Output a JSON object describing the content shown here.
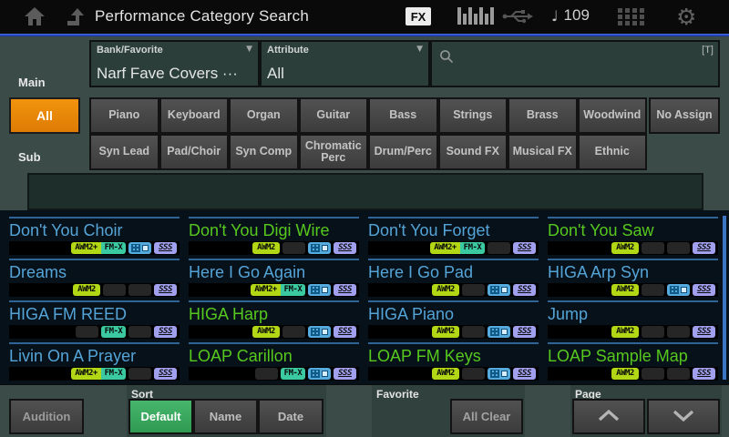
{
  "topbar": {
    "title": "Performance Category Search",
    "fx_badge": "FX",
    "tempo_value": "109",
    "tempo_note_glyph": "♩",
    "gear_glyph": "⚙"
  },
  "filters": {
    "main_label": "Main",
    "sub_label": "Sub",
    "bank": {
      "label": "Bank/Favorite",
      "value": "Narf Fave Covers ···"
    },
    "attribute": {
      "label": "Attribute",
      "value": "All"
    },
    "search": {
      "value": "",
      "type_hint": "[T]"
    },
    "dropdown_glyph": "▼"
  },
  "categories": {
    "all_label": "All",
    "row1": [
      "Piano",
      "Keyboard",
      "Organ",
      "Guitar",
      "Bass",
      "Strings",
      "Brass",
      "Woodwind"
    ],
    "no_assign_label": "No Assign",
    "row2": [
      "Syn Lead",
      "Pad/Choir",
      "Syn Comp",
      "Chromatic Perc",
      "Drum/Perc",
      "Sound FX",
      "Musical FX",
      "Ethnic"
    ]
  },
  "badges": {
    "awm2": "AWM2",
    "awm2_plus": "AWM2+",
    "fmx": "FM-X",
    "sss": "SSS"
  },
  "performances": [
    {
      "name": "Don't You Choir",
      "color": "blue",
      "awm2": true,
      "fmx": true,
      "kbd": true,
      "sss": true
    },
    {
      "name": "Don't You Digi Wire",
      "color": "green",
      "awm2": true,
      "fmx": false,
      "kbd": true,
      "sss": true
    },
    {
      "name": "Don't You Forget",
      "color": "blue",
      "awm2": true,
      "fmx": true,
      "kbd": false,
      "sss": true
    },
    {
      "name": "Don't You Saw",
      "color": "green",
      "awm2": true,
      "fmx": false,
      "kbd": false,
      "sss": true
    },
    {
      "name": "Dreams",
      "color": "blue",
      "awm2": true,
      "fmx": false,
      "kbd": false,
      "sss": true
    },
    {
      "name": "Here I Go Again",
      "color": "blue",
      "awm2": true,
      "fmx": true,
      "kbd": true,
      "sss": true
    },
    {
      "name": "Here I Go Pad",
      "color": "blue",
      "awm2": true,
      "fmx": false,
      "kbd": true,
      "sss": true
    },
    {
      "name": "HIGA Arp Syn",
      "color": "blue",
      "awm2": true,
      "fmx": false,
      "kbd": true,
      "sss": true
    },
    {
      "name": "HIGA FM REED",
      "color": "blue",
      "awm2": false,
      "fmx": true,
      "kbd": false,
      "sss": true
    },
    {
      "name": "HIGA Harp",
      "color": "green",
      "awm2": true,
      "fmx": false,
      "kbd": true,
      "sss": true
    },
    {
      "name": "HIGA Piano",
      "color": "blue",
      "awm2": true,
      "fmx": false,
      "kbd": true,
      "sss": true
    },
    {
      "name": "Jump",
      "color": "blue",
      "awm2": true,
      "fmx": false,
      "kbd": false,
      "sss": true
    },
    {
      "name": "Livin On A Prayer",
      "color": "blue",
      "awm2": true,
      "fmx": true,
      "kbd": false,
      "sss": true
    },
    {
      "name": "LOAP Carillon",
      "color": "green",
      "awm2": false,
      "fmx": true,
      "kbd": true,
      "sss": true
    },
    {
      "name": "LOAP FM Keys",
      "color": "green",
      "awm2": true,
      "fmx": false,
      "kbd": true,
      "sss": true
    },
    {
      "name": "LOAP Sample Map",
      "color": "green",
      "awm2": true,
      "fmx": false,
      "kbd": false,
      "sss": true
    }
  ],
  "bottombar": {
    "audition_label": "Audition",
    "sort_label": "Sort",
    "sort_options": [
      {
        "label": "Default",
        "active": true
      },
      {
        "label": "Name",
        "active": false
      },
      {
        "label": "Date",
        "active": false
      }
    ],
    "favorite_label": "Favorite",
    "all_clear_label": "All Clear",
    "page_label": "Page"
  },
  "colors": {
    "accent_orange": "#f2940e",
    "active_green": "#47b66c",
    "name_blue": "#54a4d8",
    "name_green": "#56c81e",
    "badge_awm2": "#b2d714",
    "badge_fmx": "#3bc9a2",
    "badge_kbd": "#55aade",
    "badge_sss": "#a0a0ef",
    "topbar_blue_line": "#2d55d4"
  }
}
